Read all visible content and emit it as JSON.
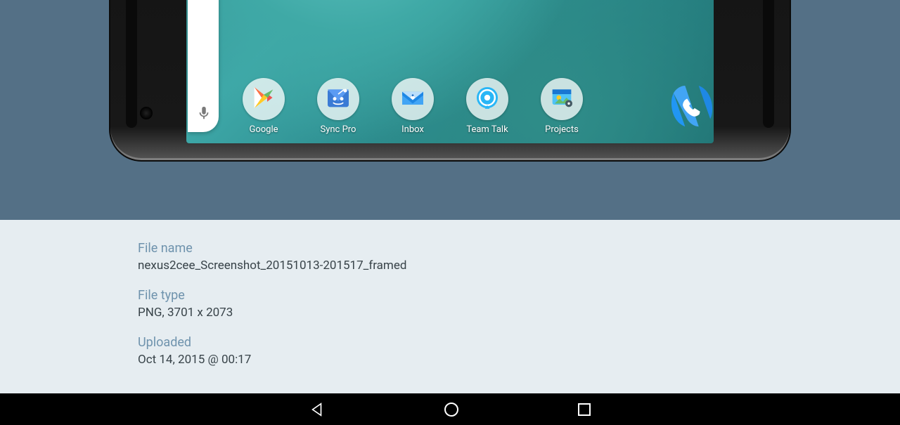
{
  "homescreen": {
    "apps": [
      {
        "label": "Google"
      },
      {
        "label": "Sync Pro"
      },
      {
        "label": "Inbox"
      },
      {
        "label": "Team Talk"
      },
      {
        "label": "Projects"
      }
    ]
  },
  "info": {
    "filename_label": "File name",
    "filename": "nexus2cee_Screenshot_20151013-201517_framed",
    "filetype_label": "File type",
    "filetype": "PNG, 3701 x 2073",
    "uploaded_label": "Uploaded",
    "uploaded": "Oct 14, 2015 @ 00:17"
  }
}
